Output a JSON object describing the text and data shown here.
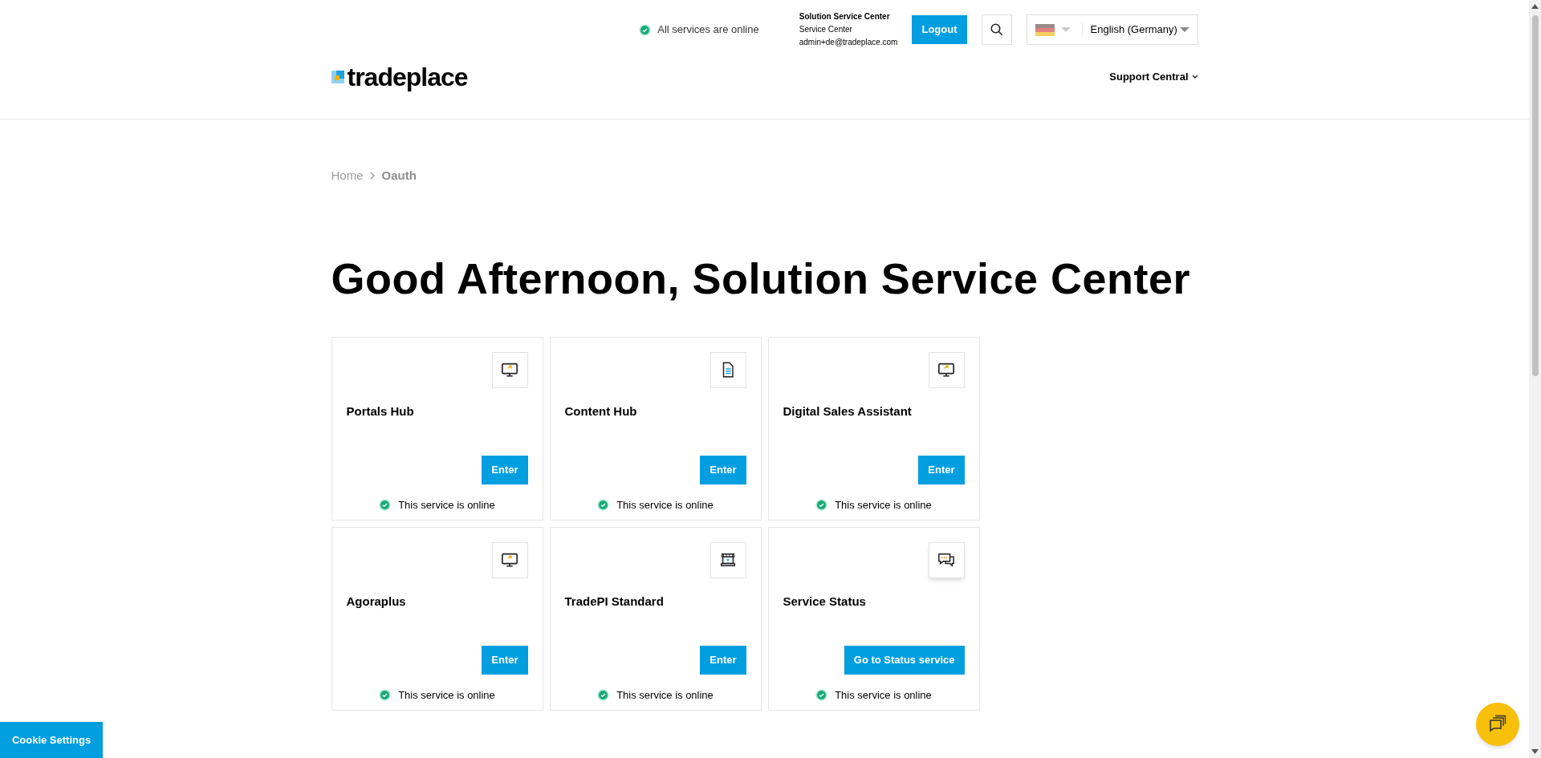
{
  "header": {
    "services_status": {
      "text": "All services are online",
      "online": true
    },
    "user": {
      "name": "Solution Service Center",
      "role": "Service Center",
      "email": "admin+de@tradeplace.com"
    },
    "logout": "Logout",
    "language": "English (Germany)",
    "logo": "tradeplace",
    "nav": [
      {
        "label": "Support Central",
        "expanded": false
      }
    ]
  },
  "breadcrumb": [
    {
      "label": "Home",
      "selected": false
    },
    {
      "label": "Oauth",
      "selected": true
    }
  ],
  "greeting": "Good Afternoon, Solution Service Center",
  "cards": [
    {
      "title": "Portals Hub",
      "kind": "monitor",
      "action": "Enter",
      "status": "This service is online",
      "online": true
    },
    {
      "title": "Content Hub",
      "kind": "document",
      "action": "Enter",
      "status": "This service is online",
      "online": true
    },
    {
      "title": "Digital Sales Assistant",
      "kind": "monitor",
      "action": "Enter",
      "status": "This service is online",
      "online": true
    },
    {
      "title": "Agoraplus",
      "kind": "monitor",
      "action": "Enter",
      "status": "This service is online",
      "online": true
    },
    {
      "title": "TradePI Standard",
      "kind": "shop",
      "action": "Enter",
      "status": "This service is online",
      "online": true
    },
    {
      "title": "Service Status",
      "kind": "chat",
      "action": "Go to Status service",
      "status": "This service is online",
      "online": true
    }
  ],
  "cookie_button": "Cookie Settings"
}
